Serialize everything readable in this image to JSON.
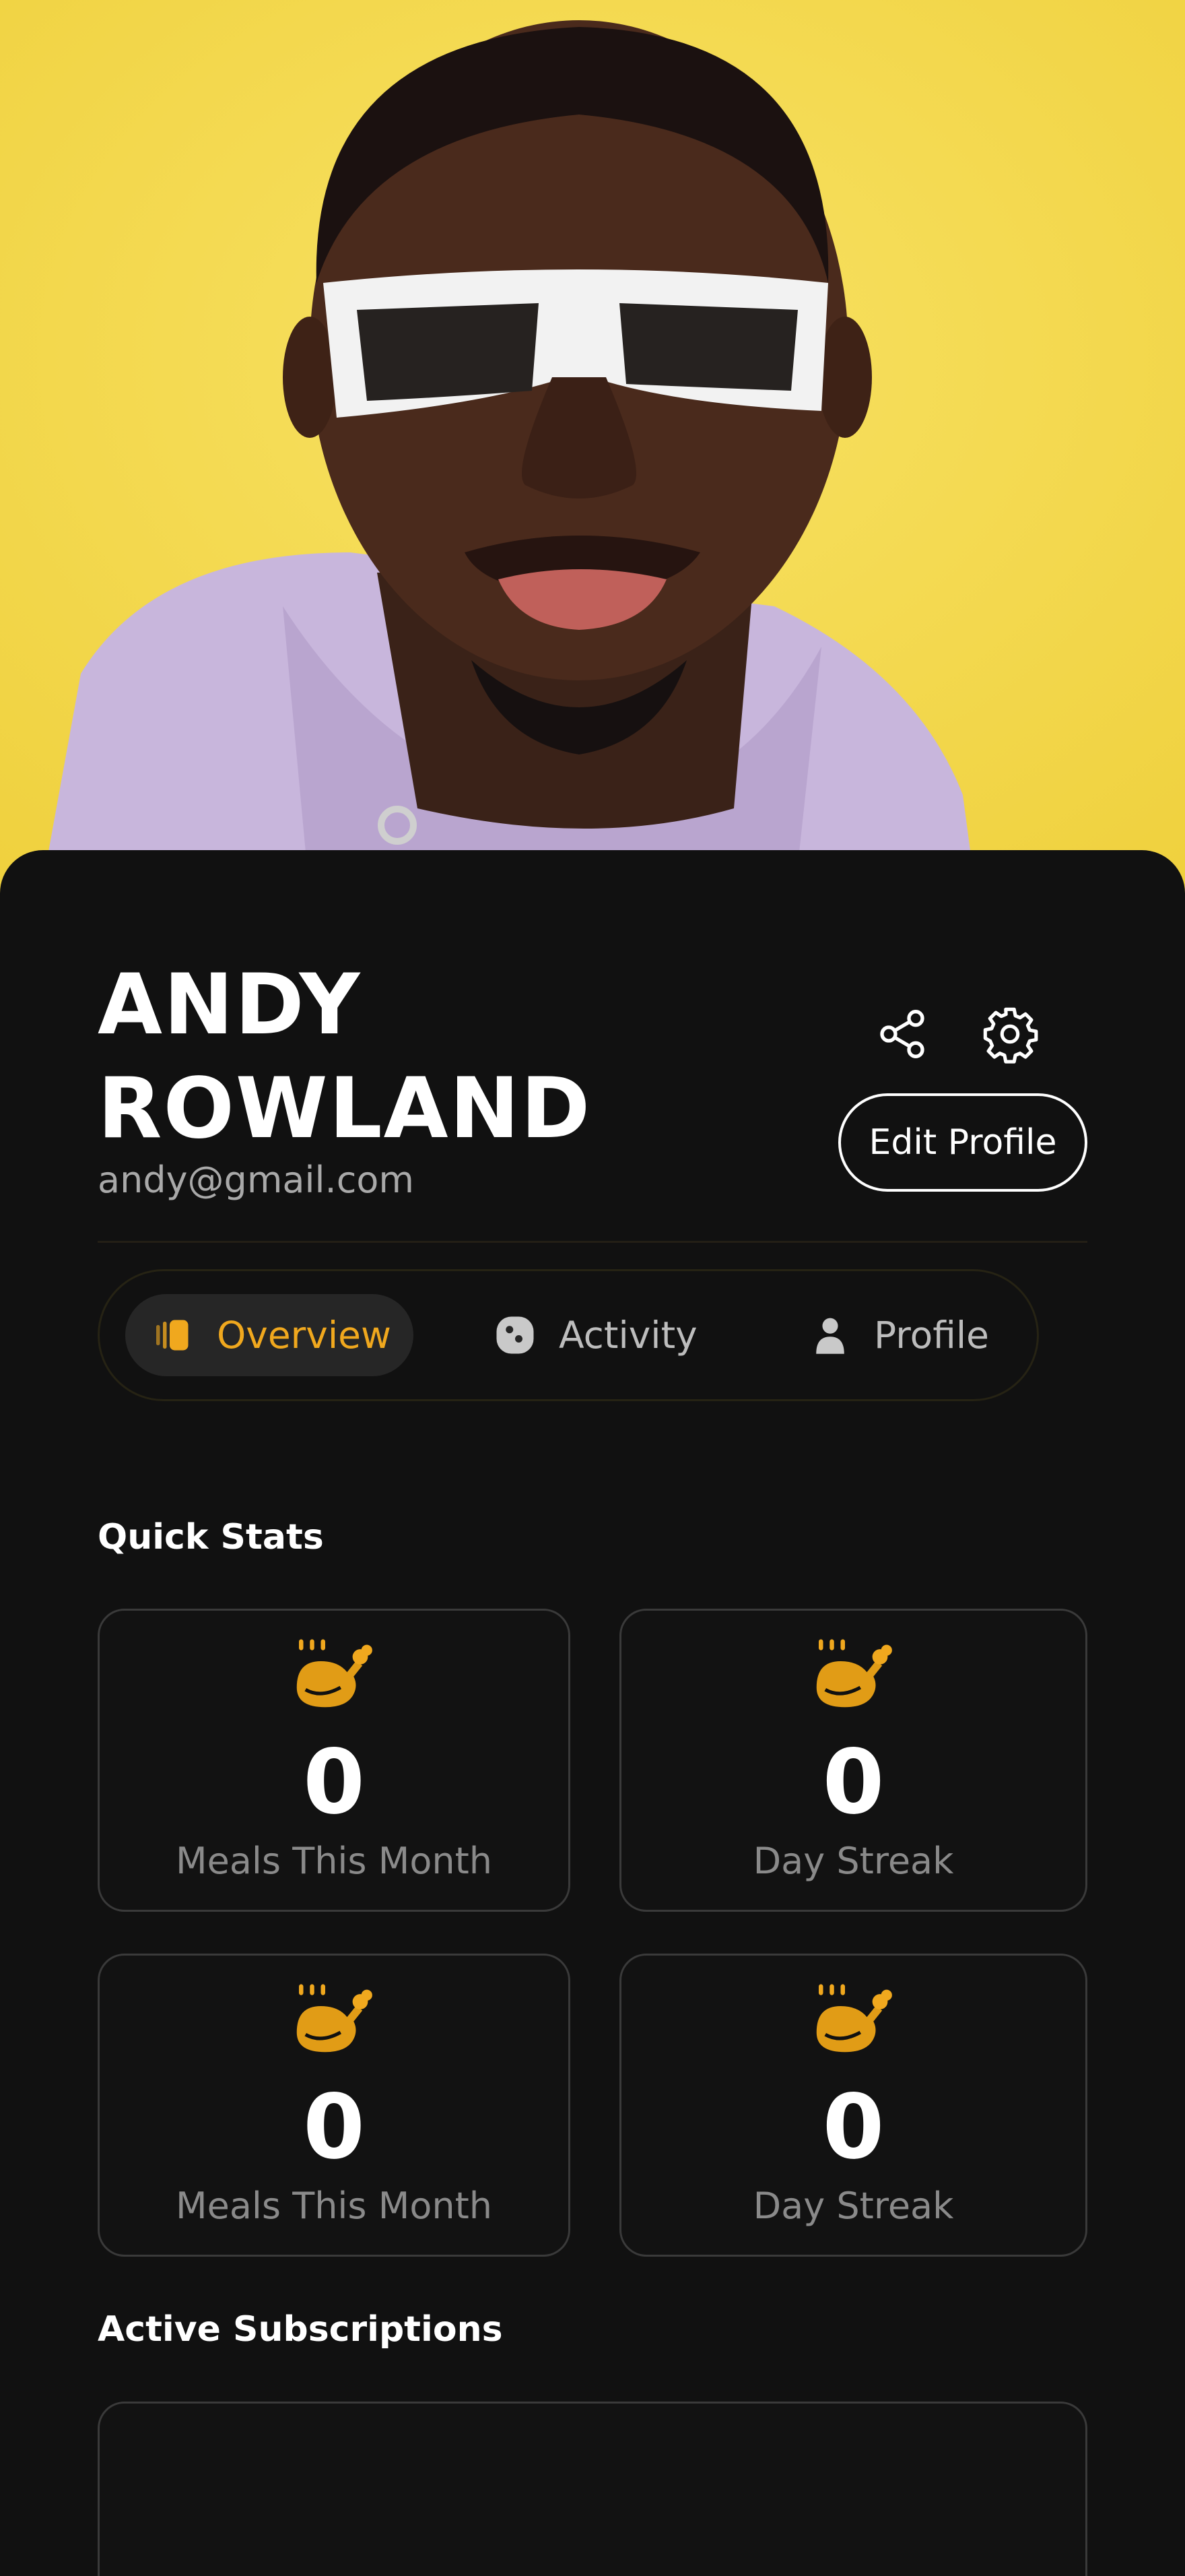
{
  "profile": {
    "name": "ANDY ROWLAND",
    "email": "andy@gmail.com"
  },
  "actions": {
    "share_icon": "share-icon",
    "settings_icon": "gear-icon",
    "edit_label": "Edit Profile"
  },
  "tabs": [
    {
      "label": "Overview",
      "icon": "overview-icon",
      "active": true
    },
    {
      "label": "Activity",
      "icon": "activity-icon",
      "active": false
    },
    {
      "label": "Profile",
      "icon": "person-icon",
      "active": false
    }
  ],
  "quick_stats": {
    "title": "Quick Stats",
    "cards": [
      {
        "value": "0",
        "label": "Meals This Month",
        "icon": "chicken-icon"
      },
      {
        "value": "0",
        "label": "Day Streak",
        "icon": "chicken-icon"
      },
      {
        "value": "0",
        "label": "Meals This Month",
        "icon": "chicken-icon"
      },
      {
        "value": "0",
        "label": "Day Streak",
        "icon": "chicken-icon"
      }
    ]
  },
  "subscriptions": {
    "title": "Active Subscriptions"
  },
  "colors": {
    "accent": "#f0a81e",
    "background": "#111111",
    "hero_background": "#f4d84a"
  }
}
